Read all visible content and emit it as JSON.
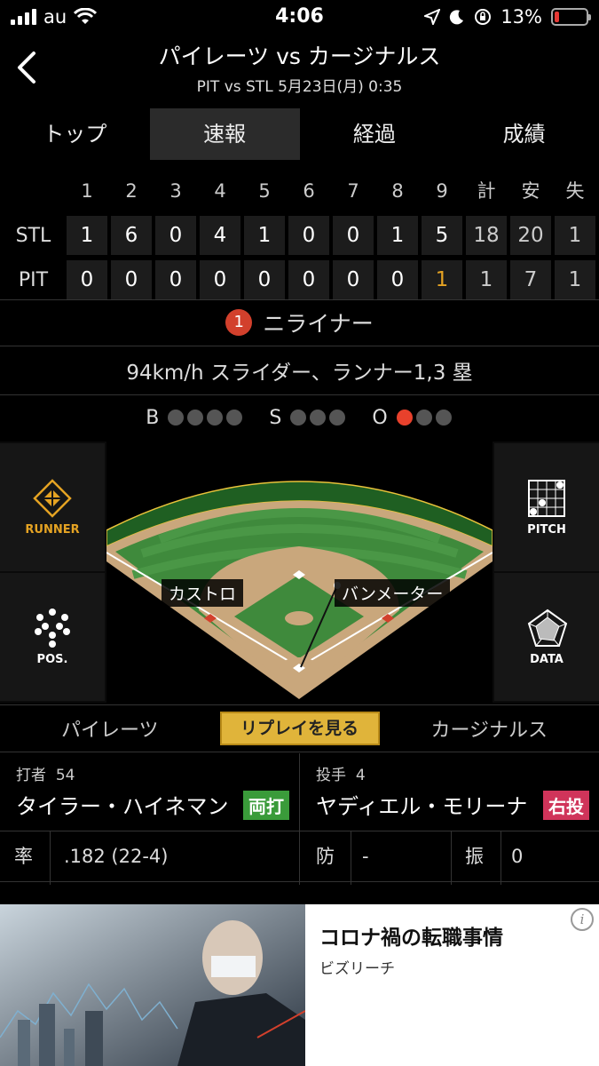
{
  "status_bar": {
    "carrier": "au",
    "time": "4:06",
    "battery": "13%"
  },
  "header": {
    "title": "パイレーツ vs カージナルス",
    "subtitle": "PIT vs STL 5月23日(月) 0:35"
  },
  "tabs": [
    {
      "label": "トップ"
    },
    {
      "label": "速報"
    },
    {
      "label": "経過"
    },
    {
      "label": "成績"
    }
  ],
  "scoreboard": {
    "headers": [
      "1",
      "2",
      "3",
      "4",
      "5",
      "6",
      "7",
      "8",
      "9",
      "計",
      "安",
      "失"
    ],
    "rows": [
      {
        "team": "STL",
        "cells": [
          "1",
          "6",
          "0",
          "4",
          "1",
          "0",
          "0",
          "1",
          "5",
          "18",
          "20",
          "1"
        ]
      },
      {
        "team": "PIT",
        "cells": [
          "0",
          "0",
          "0",
          "0",
          "0",
          "0",
          "0",
          "0",
          "1",
          "1",
          "7",
          "1"
        ]
      }
    ]
  },
  "play": {
    "outs": "1",
    "result": "ニライナー",
    "pitch": "94km/h スライダー、ランナー1,3 塁",
    "count_labels": {
      "balls": "B",
      "strikes": "S",
      "outs": "O"
    },
    "balls": 0,
    "strikes": 0,
    "outs_count": 1
  },
  "panel": {
    "runner_label": "RUNNER",
    "pitch_label": "PITCH",
    "pos_label": "POS.",
    "data_label": "DATA",
    "fielder_1": "カストロ",
    "fielder_2": "バンメーター"
  },
  "team_bar": {
    "home": "パイレーツ",
    "replay": "リプレイを見る",
    "away": "カージナルス"
  },
  "batter": {
    "role": "打者",
    "number": "54",
    "name": "タイラー・ハイネマン",
    "hand": "両打",
    "hand_color": "#3a9b3a"
  },
  "pitcher": {
    "role": "投手",
    "number": "4",
    "name": "ヤディエル・モリーナ",
    "hand": "右投",
    "hand_color": "#d0345a"
  },
  "stats": {
    "avg_label": "率",
    "avg_value": ".182 (22-4)",
    "era_label": "防",
    "era_value": "-",
    "k_label": "振",
    "k_value": "0"
  },
  "ad": {
    "title": "コロナ禍の転職事情",
    "sponsor": "ビズリーチ"
  },
  "colors": {
    "accent_orange": "#e5a323",
    "out_red": "#e8412c",
    "field_green": "#3f8a3c",
    "dirt": "#c9a77c"
  }
}
